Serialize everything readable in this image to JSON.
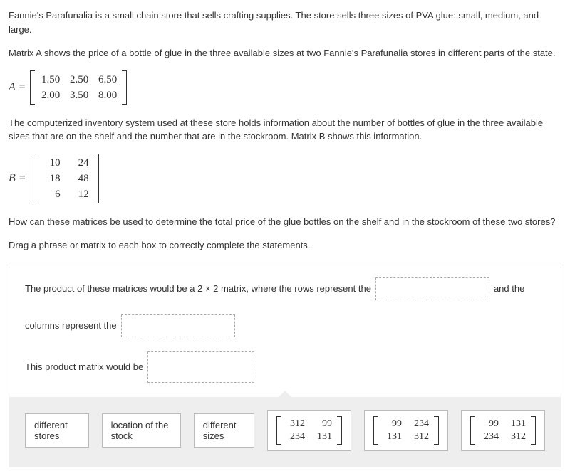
{
  "intro": {
    "p1": "Fannie's Parafunalia is a small chain store that sells crafting supplies. The store sells three sizes of PVA glue: small, medium, and large.",
    "p2": "Matrix A shows the price of a bottle of glue in the three available sizes at two Fannie's Parafunalia stores in different parts of the state."
  },
  "matrixA": {
    "lhs": "A =",
    "r1c1": "1.50",
    "r1c2": "2.50",
    "r1c3": "6.50",
    "r2c1": "2.00",
    "r2c2": "3.50",
    "r2c3": "8.00"
  },
  "mid": {
    "p1": "The computerized inventory system used at these store holds information about the number of bottles of glue in the three available sizes that are on the shelf and the number that are in the stockroom. Matrix B shows this information."
  },
  "matrixB": {
    "lhs": "B =",
    "r1c1": "10",
    "r1c2": "24",
    "r2c1": "18",
    "r2c2": "48",
    "r3c1": "6",
    "r3c2": "12"
  },
  "question": "How can these matrices be used to determine the total price of the glue bottles on the shelf and in the stockroom of these two stores?",
  "instruction": "Drag a phrase or matrix to each box to correctly complete the statements.",
  "stmt": {
    "s1a": "The product of these matrices would be a 2 × 2 matrix, where the rows represent the",
    "s1b": "and the",
    "s2a": "columns represent the",
    "s3a": "This product matrix would be"
  },
  "chips": {
    "c1": "different stores",
    "c2": "location of the stock",
    "c3": "different sizes",
    "m1": {
      "r1c1": "312",
      "r1c2": "99",
      "r2c1": "234",
      "r2c2": "131"
    },
    "m2": {
      "r1c1": "99",
      "r1c2": "234",
      "r2c1": "131",
      "r2c2": "312"
    },
    "m3": {
      "r1c1": "99",
      "r1c2": "131",
      "r2c1": "234",
      "r2c2": "312"
    }
  }
}
